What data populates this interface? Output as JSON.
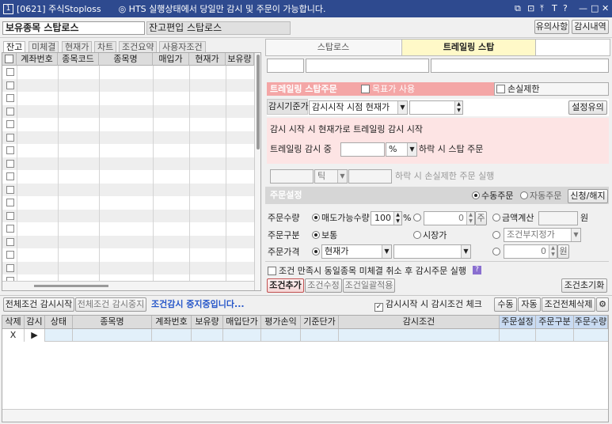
{
  "window": {
    "icon": "1",
    "title": "[0621] 주식Stoploss",
    "notice": "◎ HTS 실행상태에서 당일만 감시 및 주문이 가능합니다.",
    "controls": [
      "⧉",
      "⊡",
      "⤒",
      "T",
      "?",
      "—",
      "□",
      "✕"
    ]
  },
  "top": {
    "holding_title": "보유종목 스탑로스",
    "balance_title": "잔고편입 스탑로스",
    "caution_btn": "유의사항",
    "history_btn": "감시내역"
  },
  "left_tabs": [
    "잔고",
    "미체결",
    "현재가",
    "차트",
    "조건요약",
    "사용자조건"
  ],
  "left_columns": [
    "계좌번호",
    "종목코드",
    "종목명",
    "매입가",
    "현재가",
    "보유량"
  ],
  "right_tabs": {
    "stoploss": "스탑로스",
    "trailing": "트레일링 스탑"
  },
  "trailing": {
    "header": "트레일링 스탑주문",
    "target_label": "목표가 사용",
    "loss_label": "손실제한",
    "base_label": "감시기준가",
    "base_value": "감시시작 시점 현재가",
    "setting_btn": "설정유의",
    "desc": "감시 시작 시 현재가로 트레일링 감시 시작",
    "during_label": "트레일링 감시 중",
    "unit": "%",
    "drop_label": "하락 시 스탑 주문",
    "tick_unit": "틱",
    "loss_drop_label": "하락 시 손실제한 주문 실행"
  },
  "order": {
    "title": "주문설정",
    "manual": "수동주문",
    "auto": "자동주문",
    "type_btn": "신청/해지",
    "qty_label": "주문수량",
    "sellable": "매도가능수량",
    "pct": "100",
    "pct_unit": "%",
    "qty_value": "0",
    "qty_unit": "주",
    "amount_label": "금액계산",
    "won": "원",
    "kind_label": "주문구분",
    "normal": "보통",
    "market": "시장가",
    "cond_select": "조건부지정가",
    "price_label": "주문가격",
    "current": "현재가",
    "price_value": "0",
    "price_unit": "원",
    "cond_check": "조건 만족시 동일종목 미체결 취소 후 감시주문 실행",
    "help": "?",
    "add_btn": "조건추가",
    "edit_btn": "조건수정",
    "batch_btn": "조건일괄적용",
    "reset_btn": "조건초기화"
  },
  "bottom": {
    "start_btn": "전체조건 감시시작",
    "stop_btn": "전체조건 감시중지",
    "status": "조건감시 중지중입니다...",
    "check_label": "감시시작 시 감시조건 체크",
    "manual_btn": "수동",
    "auto_btn": "자동",
    "delete_btn": "조건전체삭제",
    "gear": "⚙"
  },
  "bottom_columns": [
    "삭제",
    "감시",
    "상태",
    "종목명",
    "계좌번호",
    "보유량",
    "매입단가",
    "평가손익",
    "기준단가",
    "감시조건",
    "주문설정",
    "주문구분",
    "주문수량"
  ],
  "bottom_row": {
    "delete": "X",
    "watch": "▶"
  },
  "colors": {
    "titlebar": "#2e4a8f",
    "accent_pink": "#f4a6a6",
    "tab_active": "#fff9c8",
    "light_pink": "#fde4e4"
  }
}
